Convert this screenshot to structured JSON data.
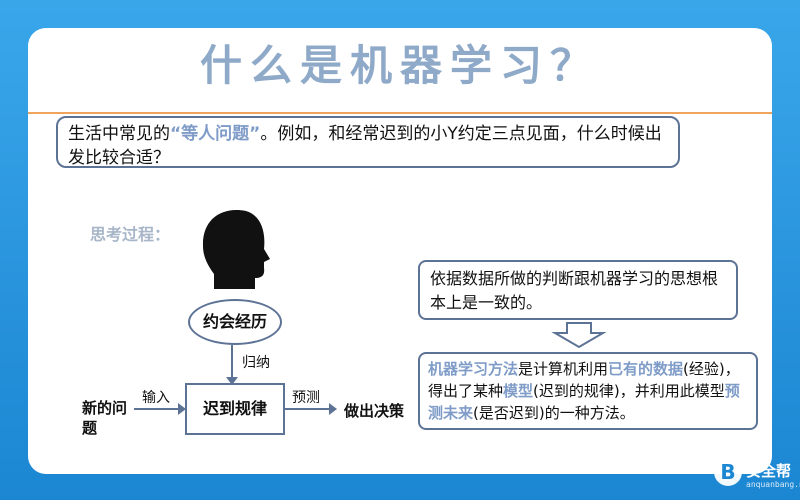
{
  "title": "什么是机器学习？",
  "intro": {
    "prefix": "生活中常见的",
    "quote": "“等人问题”",
    "suffix": "。例如，和经常迟到的小Y约定三点见面，什么时候出发比较合适？"
  },
  "thinking_label": "思考过程：",
  "diagram": {
    "appointment_history": "约会经历",
    "induce_label": "归纳",
    "rule": "迟到规律",
    "new_problem": "新的问题",
    "input_label": "输入",
    "predict_label": "预测",
    "decision": "做出决策"
  },
  "summary": "依据数据所做的判断跟机器学习的思想根本上是一致的。",
  "definition": {
    "part1": "机器学习方法",
    "part2": "是计算机利用",
    "part3": "已有的数据",
    "part4": "(经验)，得出了某种",
    "part5": "模型",
    "part6": "(迟到的规律)，并利用此模型",
    "part7": "预测未来",
    "part8": "(是否迟到)的一种方法。"
  },
  "watermark": {
    "brand": "安全帮",
    "sub": "anquanbang.net"
  },
  "icons": {
    "head": "head-profile-icon",
    "arrow_down": "down-arrow-icon",
    "logo": "b-logo-icon"
  },
  "colors": {
    "frame": "#1f8fd8",
    "title": "#8fa9c9",
    "accent": "#f0a35a",
    "highlight": "#7f9cc8",
    "border": "#5d7396"
  }
}
